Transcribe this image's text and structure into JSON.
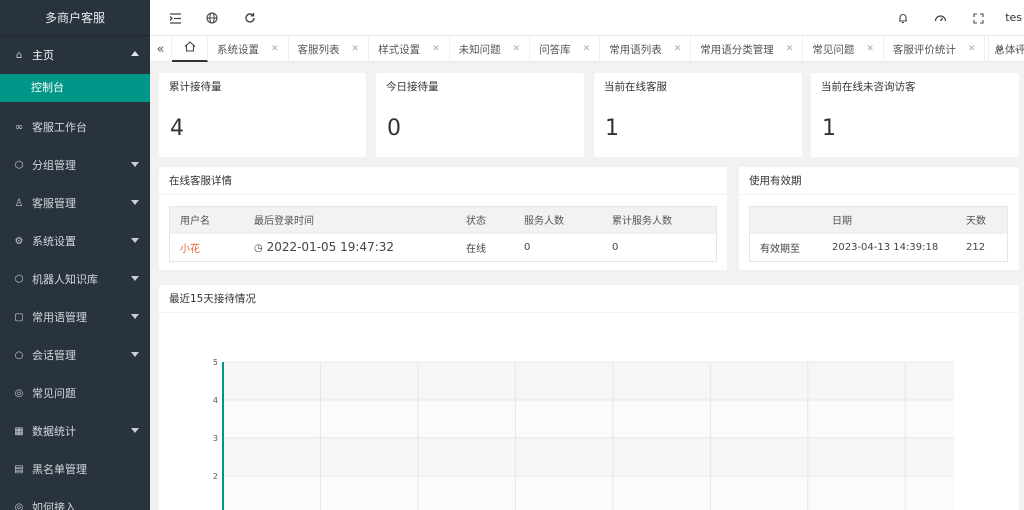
{
  "sidebar": {
    "logo": "多商户客服",
    "items": [
      {
        "label": "主页",
        "icon": "home-icon",
        "glyph": "⌂",
        "caret": "up"
      },
      {
        "label": "控制台",
        "sub": true
      },
      {
        "label": "客服工作台",
        "icon": "link-icon",
        "glyph": "∞",
        "caret": ""
      },
      {
        "label": "分组管理",
        "icon": "cube-icon",
        "glyph": "⬡",
        "caret": "down"
      },
      {
        "label": "客服管理",
        "icon": "user-icon",
        "glyph": "♙",
        "caret": "down"
      },
      {
        "label": "系统设置",
        "icon": "gear-icon",
        "glyph": "⚙",
        "caret": "down"
      },
      {
        "label": "机器人知识库",
        "icon": "robot-icon",
        "glyph": "⬡",
        "caret": "down"
      },
      {
        "label": "常用语管理",
        "icon": "note-icon",
        "glyph": "▢",
        "caret": "down"
      },
      {
        "label": "会话管理",
        "icon": "chat-icon",
        "glyph": "○",
        "caret": "down"
      },
      {
        "label": "常见问题",
        "icon": "shield-icon",
        "glyph": "◎",
        "caret": ""
      },
      {
        "label": "数据统计",
        "icon": "stats-icon",
        "glyph": "▦",
        "caret": "down"
      },
      {
        "label": "黑名单管理",
        "icon": "blacklist-icon",
        "glyph": "▤",
        "caret": ""
      },
      {
        "label": "如何接入",
        "icon": "check-icon",
        "glyph": "◎",
        "caret": ""
      }
    ]
  },
  "header": {
    "user": "tes"
  },
  "tabs": [
    {
      "label": "系统设置"
    },
    {
      "label": "客服列表"
    },
    {
      "label": "样式设置"
    },
    {
      "label": "未知问题"
    },
    {
      "label": "问答库"
    },
    {
      "label": "常用语列表"
    },
    {
      "label": "常用语分类管理"
    },
    {
      "label": "常见问题"
    },
    {
      "label": "客服评价统计"
    },
    {
      "label": "总体评价"
    }
  ],
  "stats": [
    {
      "title": "累计接待量",
      "value": "4"
    },
    {
      "title": "今日接待量",
      "value": "0"
    },
    {
      "title": "当前在线客服",
      "value": "1"
    },
    {
      "title": "当前在线未咨询访客",
      "value": "1"
    }
  ],
  "online_panel": {
    "title": "在线客服详情",
    "headers": [
      "用户名",
      "最后登录时间",
      "状态",
      "服务人数",
      "累计服务人数"
    ],
    "rows": [
      {
        "name": "小花",
        "last_login": "2022-01-05 19:47:32",
        "status": "在线",
        "serving": "0",
        "total": "0"
      }
    ]
  },
  "validity_panel": {
    "title": "使用有效期",
    "headers": [
      "",
      "日期",
      "天数"
    ],
    "row": {
      "label": "有效期至",
      "date": "2023-04-13 14:39:18",
      "days": "212"
    }
  },
  "chart_panel": {
    "title": "最近15天接待情况"
  },
  "chart_data": {
    "type": "line",
    "title": "最近15天接待情况",
    "y_ticks": [
      "5",
      "4",
      "3",
      "2"
    ],
    "ylim": [
      0,
      5
    ],
    "grid": true,
    "accent": "#009688"
  },
  "colors": {
    "sidebar_bg": "#28333e",
    "active": "#009688",
    "link": "#e06b3a"
  }
}
